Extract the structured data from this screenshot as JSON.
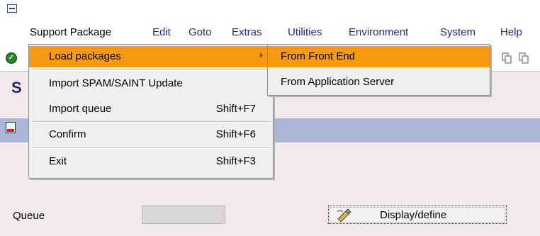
{
  "menubar": {
    "items": [
      "Support Package",
      "Edit",
      "Goto",
      "Extras",
      "Utilities",
      "Environment",
      "System",
      "Help"
    ]
  },
  "title": {
    "visible_start": "S"
  },
  "dropdown": {
    "items": [
      {
        "label": "Load packages",
        "shortcut": "",
        "has_submenu": true,
        "highlighted": true
      },
      {
        "label": "Import SPAM/SAINT Update",
        "shortcut": ""
      },
      {
        "label": "Import queue",
        "shortcut": "Shift+F7"
      },
      {
        "label": "Confirm",
        "shortcut": "Shift+F6"
      },
      {
        "label": "Exit",
        "shortcut": "Shift+F3"
      }
    ]
  },
  "submenu": {
    "items": [
      {
        "label": "From Front End",
        "highlighted": true
      },
      {
        "label": "From Application Server"
      }
    ]
  },
  "content": {
    "queue_label": "Queue",
    "queue_value": "",
    "display_define_label": "Display/define"
  },
  "colors": {
    "highlight": "#f79a10",
    "app_toolbar": "#a9b6d8",
    "background": "#f2e9ec"
  }
}
